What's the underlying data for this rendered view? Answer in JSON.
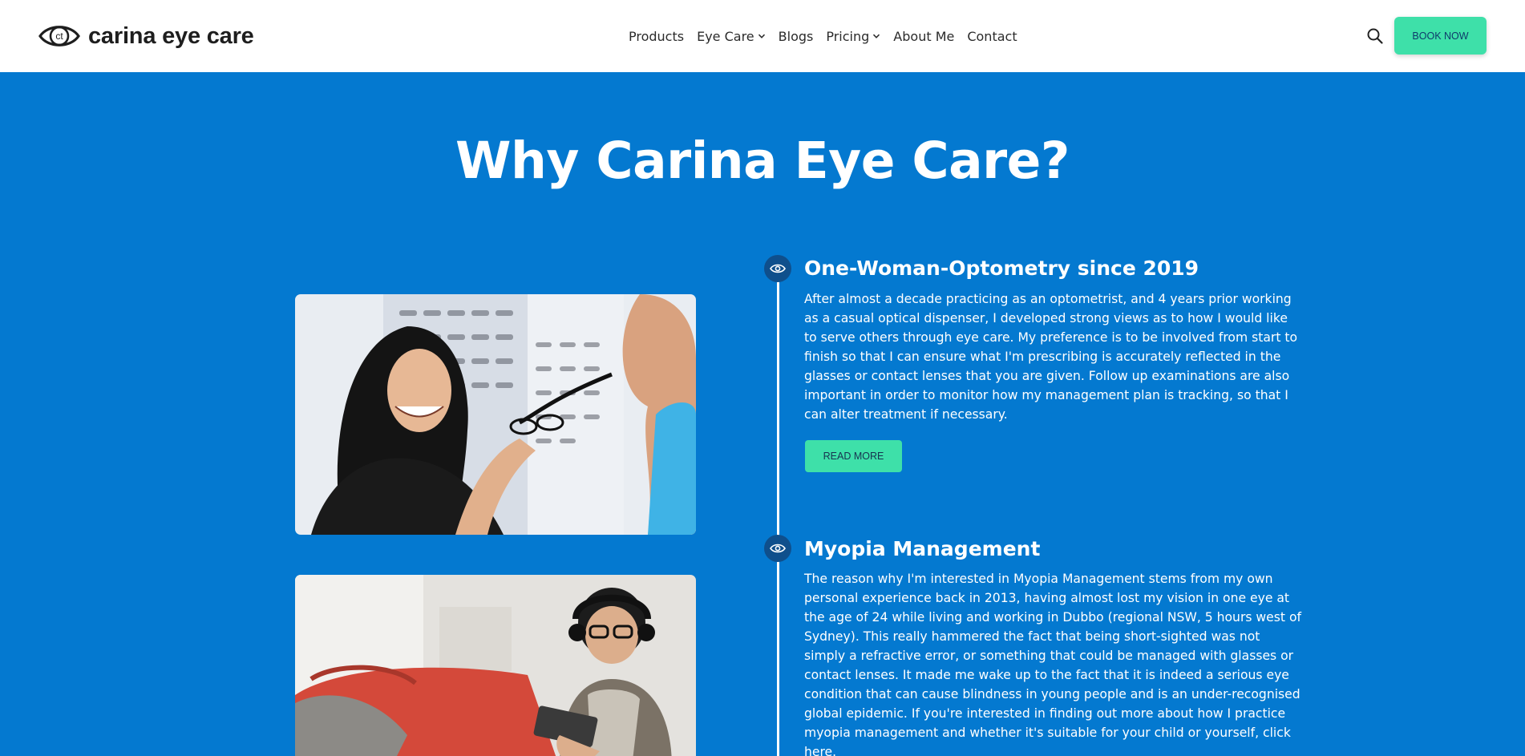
{
  "brand": {
    "name": "carina eye care",
    "mark": "ct",
    "accent": "#3ee0a9",
    "blue": "#0479d0"
  },
  "nav": {
    "items": [
      {
        "label": "Products",
        "dropdown": false
      },
      {
        "label": "Eye Care",
        "dropdown": true
      },
      {
        "label": "Blogs",
        "dropdown": false
      },
      {
        "label": "Pricing",
        "dropdown": true
      },
      {
        "label": "About Me",
        "dropdown": false
      },
      {
        "label": "Contact",
        "dropdown": false
      }
    ],
    "search_icon": "search-icon",
    "book_label": "BOOK NOW"
  },
  "section": {
    "title": "Why Carina Eye Care?",
    "items": [
      {
        "icon": "eye-icon",
        "heading": "One-Woman-Optometry since 2019",
        "body": "After almost a decade practicing as an optometrist, and 4 years prior working as a casual optical dispenser, I developed strong views as to how I would like to serve others through eye care. My preference is to be involved from start to finish so that I can ensure what I'm prescribing is accurately reflected in the glasses or contact lenses that you are given. Follow up examinations are also important in order to monitor how my management plan is tracking, so that I can alter treatment if necessary.",
        "button": "READ MORE"
      },
      {
        "icon": "eye-icon",
        "heading": "Myopia Management",
        "body": "The reason why I'm interested in Myopia Management stems from my own personal experience back in 2013, having almost lost my vision in one eye at the age of 24 while living and working in Dubbo (regional NSW, 5 hours west of Sydney). This really hammered the fact that being short-sighted was not simply a refractive error, or something that could be managed with glasses or contact lenses. It made me wake up to the fact that it is indeed a serious eye condition that can cause blindness in young people and is an under-recognised global epidemic. If you're interested in finding out more about how I practice myopia management and whether it's suitable for your child or yourself, click here."
      }
    ]
  }
}
